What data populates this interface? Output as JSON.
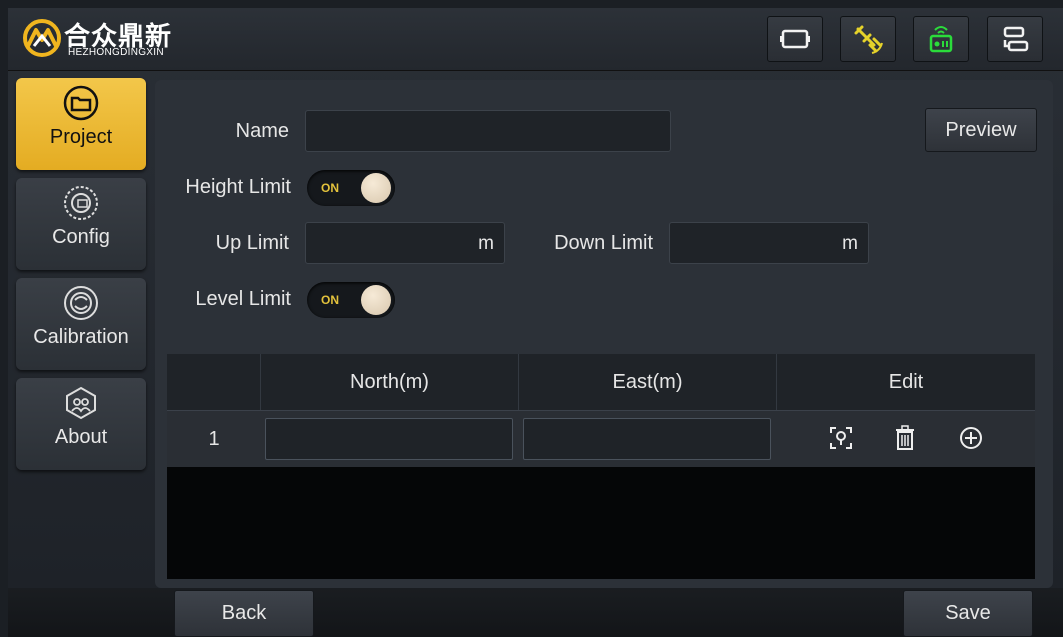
{
  "header": {
    "logo_brand": "合众鼎新",
    "logo_sub": "HEZHONGDINGXIN",
    "status_icons": [
      "screen-icon",
      "satellite-icon",
      "radio-icon",
      "settings-sync-icon"
    ]
  },
  "sidebar": {
    "items": [
      {
        "label": "Project",
        "icon": "folder-icon",
        "active": true
      },
      {
        "label": "Config",
        "icon": "gear-icon",
        "active": false
      },
      {
        "label": "Calibration",
        "icon": "calibration-icon",
        "active": false
      },
      {
        "label": "About",
        "icon": "about-icon",
        "active": false
      }
    ]
  },
  "form": {
    "name_label": "Name",
    "name_value": "",
    "preview_label": "Preview",
    "height_limit_label": "Height Limit",
    "height_limit_state": "ON",
    "up_limit_label": "Up Limit",
    "up_limit_value": "",
    "up_limit_unit": "m",
    "down_limit_label": "Down Limit",
    "down_limit_value": "",
    "down_limit_unit": "m",
    "level_limit_label": "Level Limit",
    "level_limit_state": "ON"
  },
  "table": {
    "columns": [
      "",
      "North(m)",
      "East(m)",
      "Edit"
    ],
    "rows": [
      {
        "index": "1",
        "north": "",
        "east": ""
      }
    ],
    "edit_icons": [
      "scan-icon",
      "trash-icon",
      "add-circle-icon"
    ]
  },
  "footer": {
    "back_label": "Back",
    "save_label": "Save"
  },
  "colors": {
    "accent": "#f0c03e",
    "panel": "#2c3138",
    "status_green": "#2bdc3b",
    "status_yellow": "#e5d22a"
  }
}
